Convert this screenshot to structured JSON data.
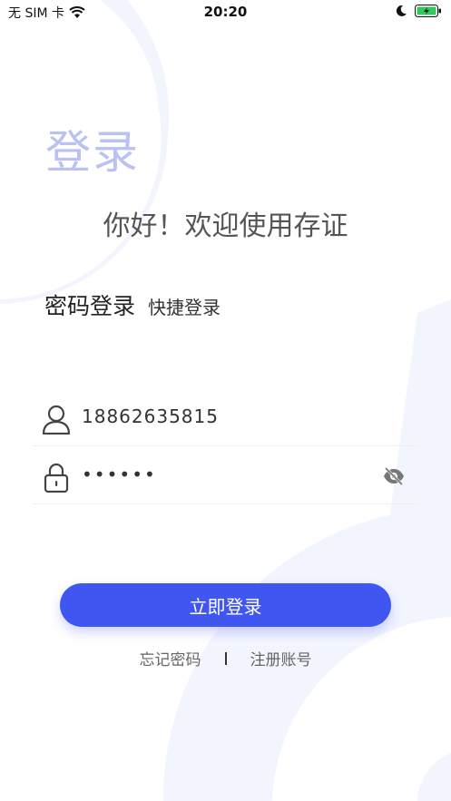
{
  "status_bar": {
    "carrier": "无 SIM 卡",
    "time": "20:20",
    "icons": [
      "wifi-icon",
      "moon-icon",
      "battery-charging-icon"
    ]
  },
  "page": {
    "title": "登录",
    "welcome": "你好！欢迎使用存证"
  },
  "tabs": [
    {
      "label": "密码登录",
      "active": true
    },
    {
      "label": "快捷登录",
      "active": false
    }
  ],
  "form": {
    "phone": {
      "value": "18862635815",
      "icon": "user-icon"
    },
    "password": {
      "value": "••••••",
      "icon": "lock-icon",
      "toggle_icon": "eye-off-icon"
    }
  },
  "actions": {
    "login_label": "立即登录",
    "forgot_label": "忘记密码",
    "register_label": "注册账号"
  },
  "colors": {
    "accent": "#3f56f0",
    "title": "#b9c1f5",
    "background_shapes": "#f2f4fe"
  }
}
